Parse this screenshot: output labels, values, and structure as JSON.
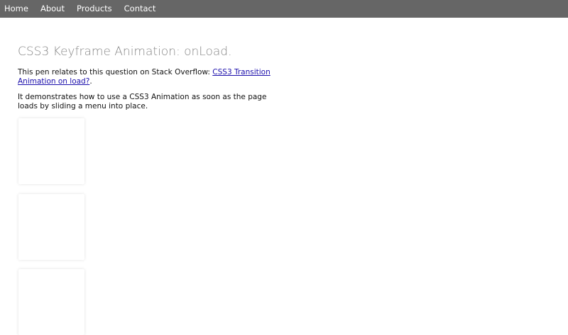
{
  "nav": {
    "items": [
      {
        "label": "Home"
      },
      {
        "label": "About"
      },
      {
        "label": "Products"
      },
      {
        "label": "Contact"
      }
    ]
  },
  "main": {
    "title": "CSS3 Keyframe Animation: onLoad.",
    "para1_prefix": "This pen relates to this question on Stack Overflow: ",
    "para1_link": "CSS3 Transition Animation on load?",
    "para1_suffix": ".",
    "para2": "It demonstrates how to use a CSS3 Animation as soon as the page loads by sliding a menu into place."
  },
  "colors": {
    "nav_bg": "#666666",
    "link": "#1a0dab",
    "title": "#888888"
  }
}
